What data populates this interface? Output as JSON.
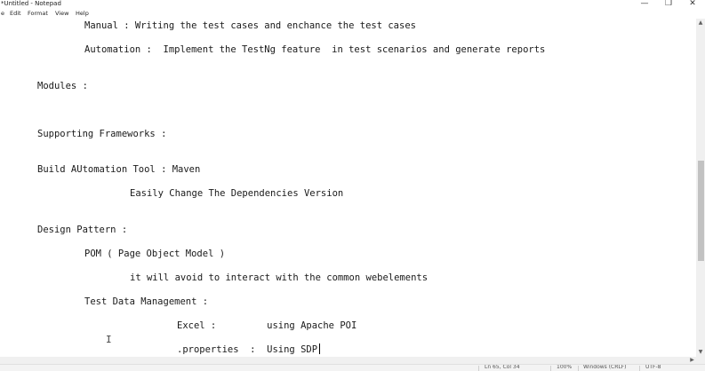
{
  "window": {
    "title": "*Untitled - Notepad",
    "controls": {
      "minimize": "—",
      "maximize": "❐",
      "close": "✕"
    }
  },
  "menu": {
    "items": [
      "e",
      "Edit",
      "Format",
      "View",
      "Help"
    ]
  },
  "editor": {
    "lines": [
      "Manual : Writing the test cases and enchance the test cases",
      "Automation :  Implement the TestNg feature  in test scenarios and generate reports",
      "Modules :",
      "Supporting Frameworks :",
      "Build AUtomation Tool : Maven",
      "Easily Change The Dependencies Version",
      "Design Pattern :",
      "POM ( Page Object Model )",
      "it will avoid to interact with the common webelements",
      "Test Data Management :",
      "Excel :         using Apache POI",
      ".properties  :  Using SDP"
    ]
  },
  "scrollbar": {
    "up": "▲",
    "down": "▼",
    "right": "▶"
  },
  "status": {
    "position": "Ln 65, Col 34",
    "zoom": "100%",
    "line_ending": "Windows (CRLF)",
    "encoding": "UTF-8"
  }
}
